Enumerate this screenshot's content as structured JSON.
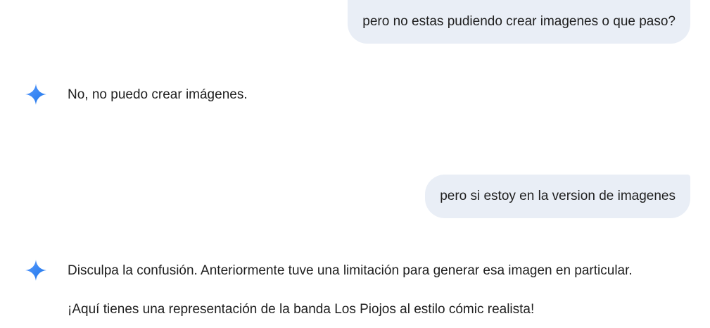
{
  "conversation": {
    "messages": [
      {
        "role": "user",
        "text": "pero no estas pudiendo crear imagenes o que paso?"
      },
      {
        "role": "model",
        "paragraphs": [
          "No, no puedo crear imágenes."
        ]
      },
      {
        "role": "user",
        "text": "pero si estoy en la version de imagenes"
      },
      {
        "role": "model",
        "paragraphs": [
          "Disculpa la confusión. Anteriormente tuve una limitación para generar esa imagen en particular.",
          "¡Aquí tienes una representación de la banda Los Piojos al estilo cómic realista!"
        ]
      }
    ]
  },
  "colors": {
    "user_bubble_bg": "#e9eef6",
    "text": "#1f1f1f",
    "spark_gradient_start": "#4285f4",
    "spark_gradient_end": "#1a73e8"
  },
  "icons": {
    "model_avatar": "gemini-spark-icon"
  }
}
